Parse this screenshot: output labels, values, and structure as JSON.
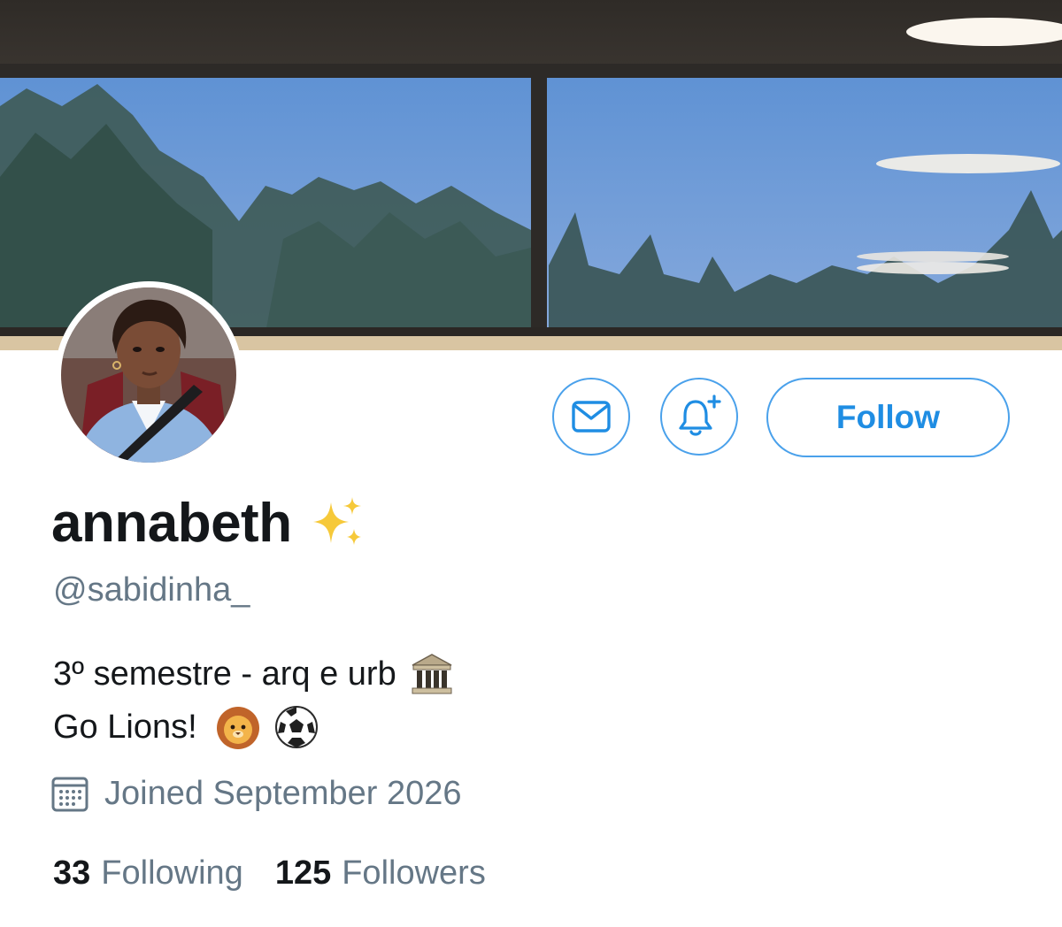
{
  "profile": {
    "display_name": "annabeth",
    "handle": "@sabidinha_",
    "bio_line_1": "3º semestre - arq e urb",
    "bio_line_2": "Go Lions!",
    "joined": "Joined September 2026"
  },
  "actions": {
    "follow_label": "Follow"
  },
  "stats": {
    "following_count": "33",
    "following_label": "Following",
    "followers_count": "125",
    "followers_label": "Followers"
  },
  "icons": {
    "name_emoji": "sparkles-icon",
    "bio_line_1_emoji": "classical-building-icon",
    "bio_line_2_emojis": [
      "lion-face-icon",
      "soccer-ball-icon"
    ],
    "message": "envelope-icon",
    "notify": "bell-plus-icon",
    "joined": "calendar-icon"
  },
  "colors": {
    "accent": "#1f8de3",
    "button_border": "#4aa1eb",
    "secondary_text": "#657786",
    "primary_text": "#14171a"
  }
}
